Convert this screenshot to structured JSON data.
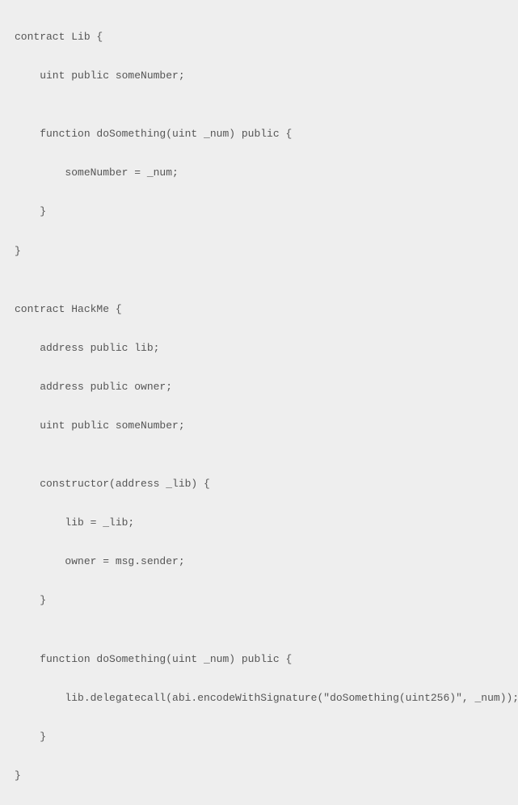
{
  "code": {
    "lines": [
      "contract Lib {",
      "    uint public someNumber;",
      "",
      "    function doSomething(uint _num) public {",
      "        someNumber = _num;",
      "    }",
      "}",
      "",
      "contract HackMe {",
      "    address public lib;",
      "    address public owner;",
      "    uint public someNumber;",
      "",
      "    constructor(address _lib) {",
      "        lib = _lib;",
      "        owner = msg.sender;",
      "    }",
      "",
      "    function doSomething(uint _num) public {",
      "        lib.delegatecall(abi.encodeWithSignature(\"doSomething(uint256)\", _num));",
      "    }",
      "}"
    ]
  }
}
